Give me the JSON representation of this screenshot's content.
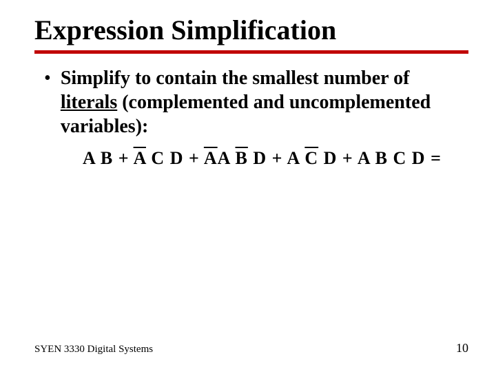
{
  "title": "Expression Simplification",
  "bullet": {
    "pre": "Simplify to contain the smallest number of ",
    "literals": "literals",
    "post": " (complemented and uncomplemented variables):"
  },
  "expr": {
    "t1": "A B",
    "plus": " + ",
    "Abar": "A",
    "t2rest": " C D",
    "Bbar": "B",
    "t3pre": "A ",
    "t3post": " D",
    "Cbar": "C",
    "t4pre": "A ",
    "t4post": " D",
    "t5": "A B C D",
    "eq": " ="
  },
  "footer": {
    "course": "SYEN 3330 Digital Systems",
    "page": "10"
  }
}
